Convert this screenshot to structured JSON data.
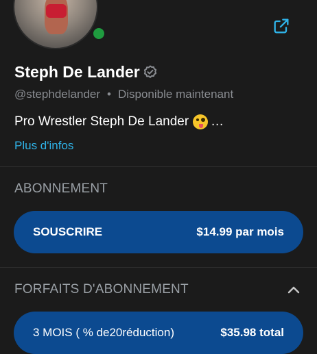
{
  "profile": {
    "name": "Steph De Lander",
    "handle": "@stephdelander",
    "separator": "•",
    "status": "Disponible maintenant",
    "bio": "Pro Wrestler Steph De Lander",
    "bio_ellipsis": "…",
    "more_link": "Plus d'infos",
    "online_color": "#1f9b3f"
  },
  "subscription": {
    "title": "ABONNEMENT",
    "button_label": "SOUSCRIRE",
    "button_price": "$14.99 par mois"
  },
  "bundles": {
    "title": "FORFAITS D'ABONNEMENT",
    "items": [
      {
        "label": "3 MOIS ( % de20réduction)",
        "price": "$35.98 total"
      }
    ]
  },
  "colors": {
    "accent": "#2fb3e8",
    "button": "#0c4a90",
    "background": "#1b1b1b"
  },
  "icons": {
    "share": "share-icon",
    "verified": "verified-badge-icon",
    "chevron": "chevron-up-icon",
    "emoji": "zany-face-emoji"
  }
}
